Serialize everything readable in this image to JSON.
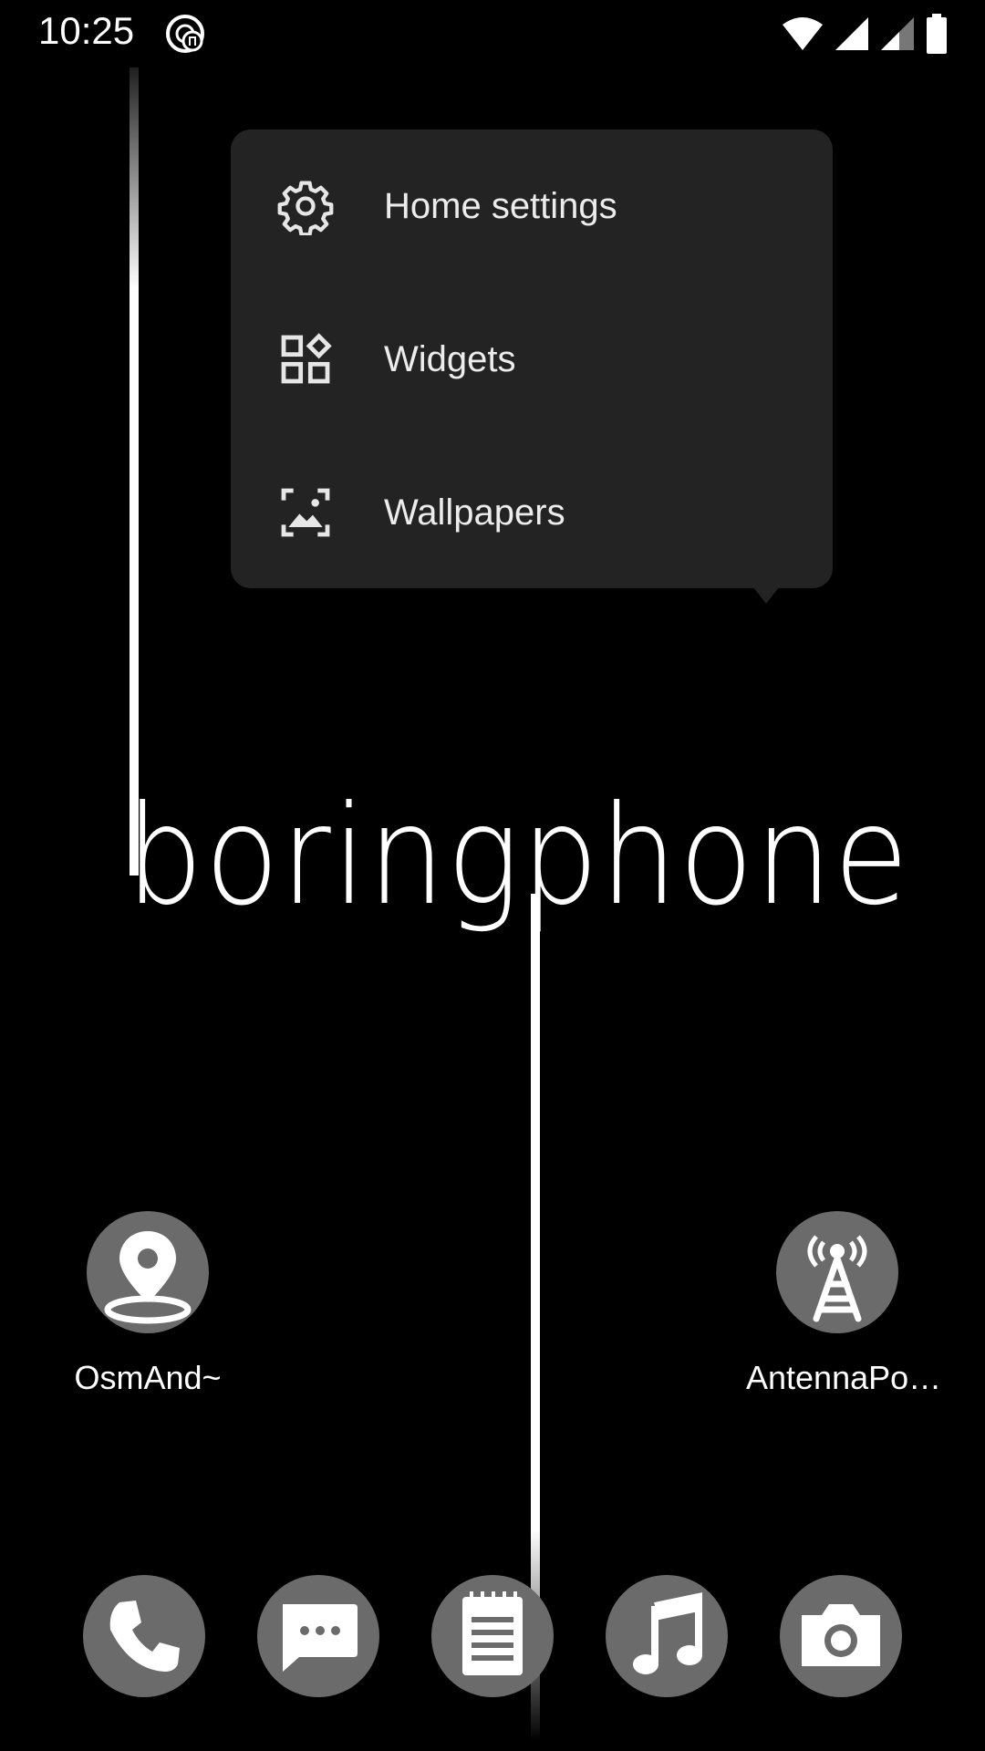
{
  "status_bar": {
    "time": "10:25",
    "notification_icon": "podcast-notification-icon",
    "icons": [
      "wifi-icon",
      "signal-icon",
      "signal-icon-2",
      "battery-icon"
    ]
  },
  "popup_menu": {
    "items": [
      {
        "label": "Home settings",
        "icon": "gear-icon"
      },
      {
        "label": "Widgets",
        "icon": "widgets-icon"
      },
      {
        "label": "Wallpapers",
        "icon": "wallpaper-icon"
      }
    ]
  },
  "wallpaper": {
    "brand": "boringphone"
  },
  "home_apps": [
    {
      "label": "OsmAnd~",
      "icon": "map-pin-icon"
    },
    {
      "label": "AntennaPo…",
      "icon": "antenna-icon"
    }
  ],
  "dock": [
    {
      "icon": "phone-icon"
    },
    {
      "icon": "messages-icon"
    },
    {
      "icon": "notes-icon"
    },
    {
      "icon": "music-icon"
    },
    {
      "icon": "camera-icon"
    }
  ],
  "colors": {
    "background": "#000000",
    "menu_background": "#232323",
    "icon_circle": "#6b6b6b",
    "text": "#ffffff"
  }
}
